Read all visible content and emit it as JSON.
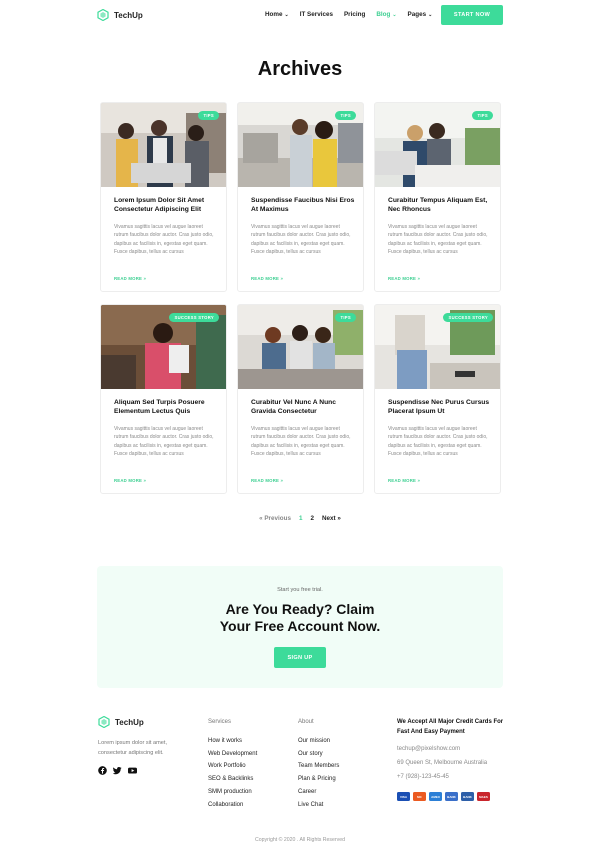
{
  "brand": {
    "name": "TechUp"
  },
  "nav": {
    "items": [
      {
        "label": "Home",
        "has_dropdown": true,
        "active": false
      },
      {
        "label": "IT Services",
        "has_dropdown": false,
        "active": false
      },
      {
        "label": "Pricing",
        "has_dropdown": false,
        "active": false
      },
      {
        "label": "Blog",
        "has_dropdown": true,
        "active": true
      },
      {
        "label": "Pages",
        "has_dropdown": true,
        "active": false
      }
    ],
    "cta_label": "START NOW"
  },
  "page_title": "Archives",
  "posts": [
    {
      "badge": "TIPS",
      "title": "Lorem Ipsum Dolor Sit Amet Consectetur Adipiscing Elit",
      "excerpt": "Vivamus sagittis lacus vel augue laoreet rutrum faucibus dolor auctor. Cras justo odio, dapibus ac facilisis in, egestas eget quam. Fusce dapibus, tellus ac cursus",
      "read_more": "READ MORE »"
    },
    {
      "badge": "TIPS",
      "title": "Suspendisse Faucibus Nisi Eros At Maximus",
      "excerpt": "Vivamus sagittis lacus vel augue laoreet rutrum faucibus dolor auctor. Cras justo odio, dapibus ac facilisis in, egestas eget quam. Fusce dapibus, tellus ac cursus",
      "read_more": "READ MORE »"
    },
    {
      "badge": "TIPS",
      "title": "Curabitur Tempus Aliquam Est, Nec Rhoncus",
      "excerpt": "Vivamus sagittis lacus vel augue laoreet rutrum faucibus dolor auctor. Cras justo odio, dapibus ac facilisis in, egestas eget quam. Fusce dapibus, tellus ac cursus",
      "read_more": "READ MORE »"
    },
    {
      "badge": "SUCCESS STORY",
      "title": "Aliquam Sed Turpis Posuere Elementum Lectus Quis",
      "excerpt": "Vivamus sagittis lacus vel augue laoreet rutrum faucibus dolor auctor. Cras justo odio, dapibus ac facilisis in, egestas eget quam. Fusce dapibus, tellus ac cursus",
      "read_more": "READ MORE »"
    },
    {
      "badge": "TIPS",
      "title": "Curabitur Vel Nunc A Nunc Gravida Consectetur",
      "excerpt": "Vivamus sagittis lacus vel augue laoreet rutrum faucibus dolor auctor. Cras justo odio, dapibus ac facilisis in, egestas eget quam. Fusce dapibus, tellus ac cursus",
      "read_more": "READ MORE »"
    },
    {
      "badge": "SUCCESS STORY",
      "title": "Suspendisse Nec Purus Cursus Placerat Ipsum Ut",
      "excerpt": "Vivamus sagittis lacus vel augue laoreet rutrum faucibus dolor auctor. Cras justo odio, dapibus ac facilisis in, egestas eget quam. Fusce dapibus, tellus ac cursus",
      "read_more": "READ MORE »"
    }
  ],
  "pagination": {
    "previous": "« Previous",
    "current": "1",
    "page_2": "2",
    "next": "Next »"
  },
  "cta": {
    "small": "Start you free trial.",
    "title_line1": "Are You Ready? Claim",
    "title_line2": "Your Free Account Now.",
    "button": "SIGN UP"
  },
  "footer": {
    "description": "Lorem ipsum dolor sit amet, consectetur adipiscing elit.",
    "social": [
      "facebook-icon",
      "twitter-icon",
      "youtube-icon"
    ],
    "services": {
      "title": "Services",
      "links": [
        "How it works",
        "Web Development",
        "Work Portfolio",
        "SEO & Backlinks",
        "SMM production",
        "Collaboration"
      ]
    },
    "about": {
      "title": "About",
      "links": [
        "Our mission",
        "Our story",
        "Team Members",
        "Plan & Pricing",
        "Career",
        "Live Chat"
      ]
    },
    "payment_title": "We Accept All Major Credit Cards For Fast And Easy Payment",
    "email": "techup@pixelshow.com",
    "address": "69 Queen St, Melbourne Australia",
    "phone": "+7 (928)-123-45-45",
    "cards": [
      {
        "name": "VISA",
        "color": "#1a4fb4"
      },
      {
        "name": "MC",
        "color": "#eb5a21"
      },
      {
        "name": "AMEX",
        "color": "#2b7fd6"
      },
      {
        "name": "BANK",
        "color": "#3a6fc9"
      },
      {
        "name": "BANK",
        "color": "#2d5fa8"
      },
      {
        "name": "MAES",
        "color": "#c9252c"
      }
    ],
    "copyright": "Copyright © 2020 . All Rights Reserved"
  },
  "colors": {
    "accent": "#3ddb9a",
    "cta_bg": "#f1fdf7"
  }
}
